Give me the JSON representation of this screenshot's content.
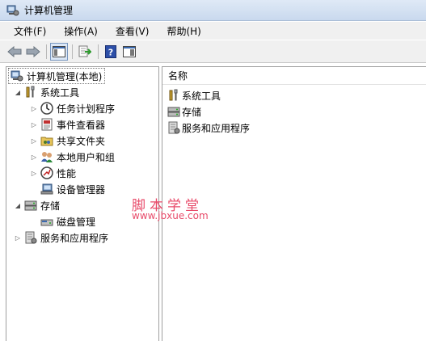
{
  "window": {
    "title": "计算机管理"
  },
  "menu": [
    "文件(F)",
    "操作(A)",
    "查看(V)",
    "帮助(H)"
  ],
  "toolbar": {
    "icons": [
      "back-arrow-icon",
      "forward-arrow-icon",
      "show-tree-icon",
      "export-list-icon",
      "help-icon",
      "console-pane-icon"
    ]
  },
  "tree": {
    "root": "计算机管理(本地)",
    "system_tools": "系统工具",
    "task_scheduler": "任务计划程序",
    "event_viewer": "事件查看器",
    "shared_folders": "共享文件夹",
    "local_users": "本地用户和组",
    "performance": "性能",
    "device_manager": "设备管理器",
    "storage": "存储",
    "disk_management": "磁盘管理",
    "services": "服务和应用程序"
  },
  "list": {
    "header": "名称",
    "items": [
      "系统工具",
      "存储",
      "服务和应用程序"
    ]
  },
  "watermark": {
    "line1": "脚本学堂",
    "line2": "www.jbxue.com"
  }
}
